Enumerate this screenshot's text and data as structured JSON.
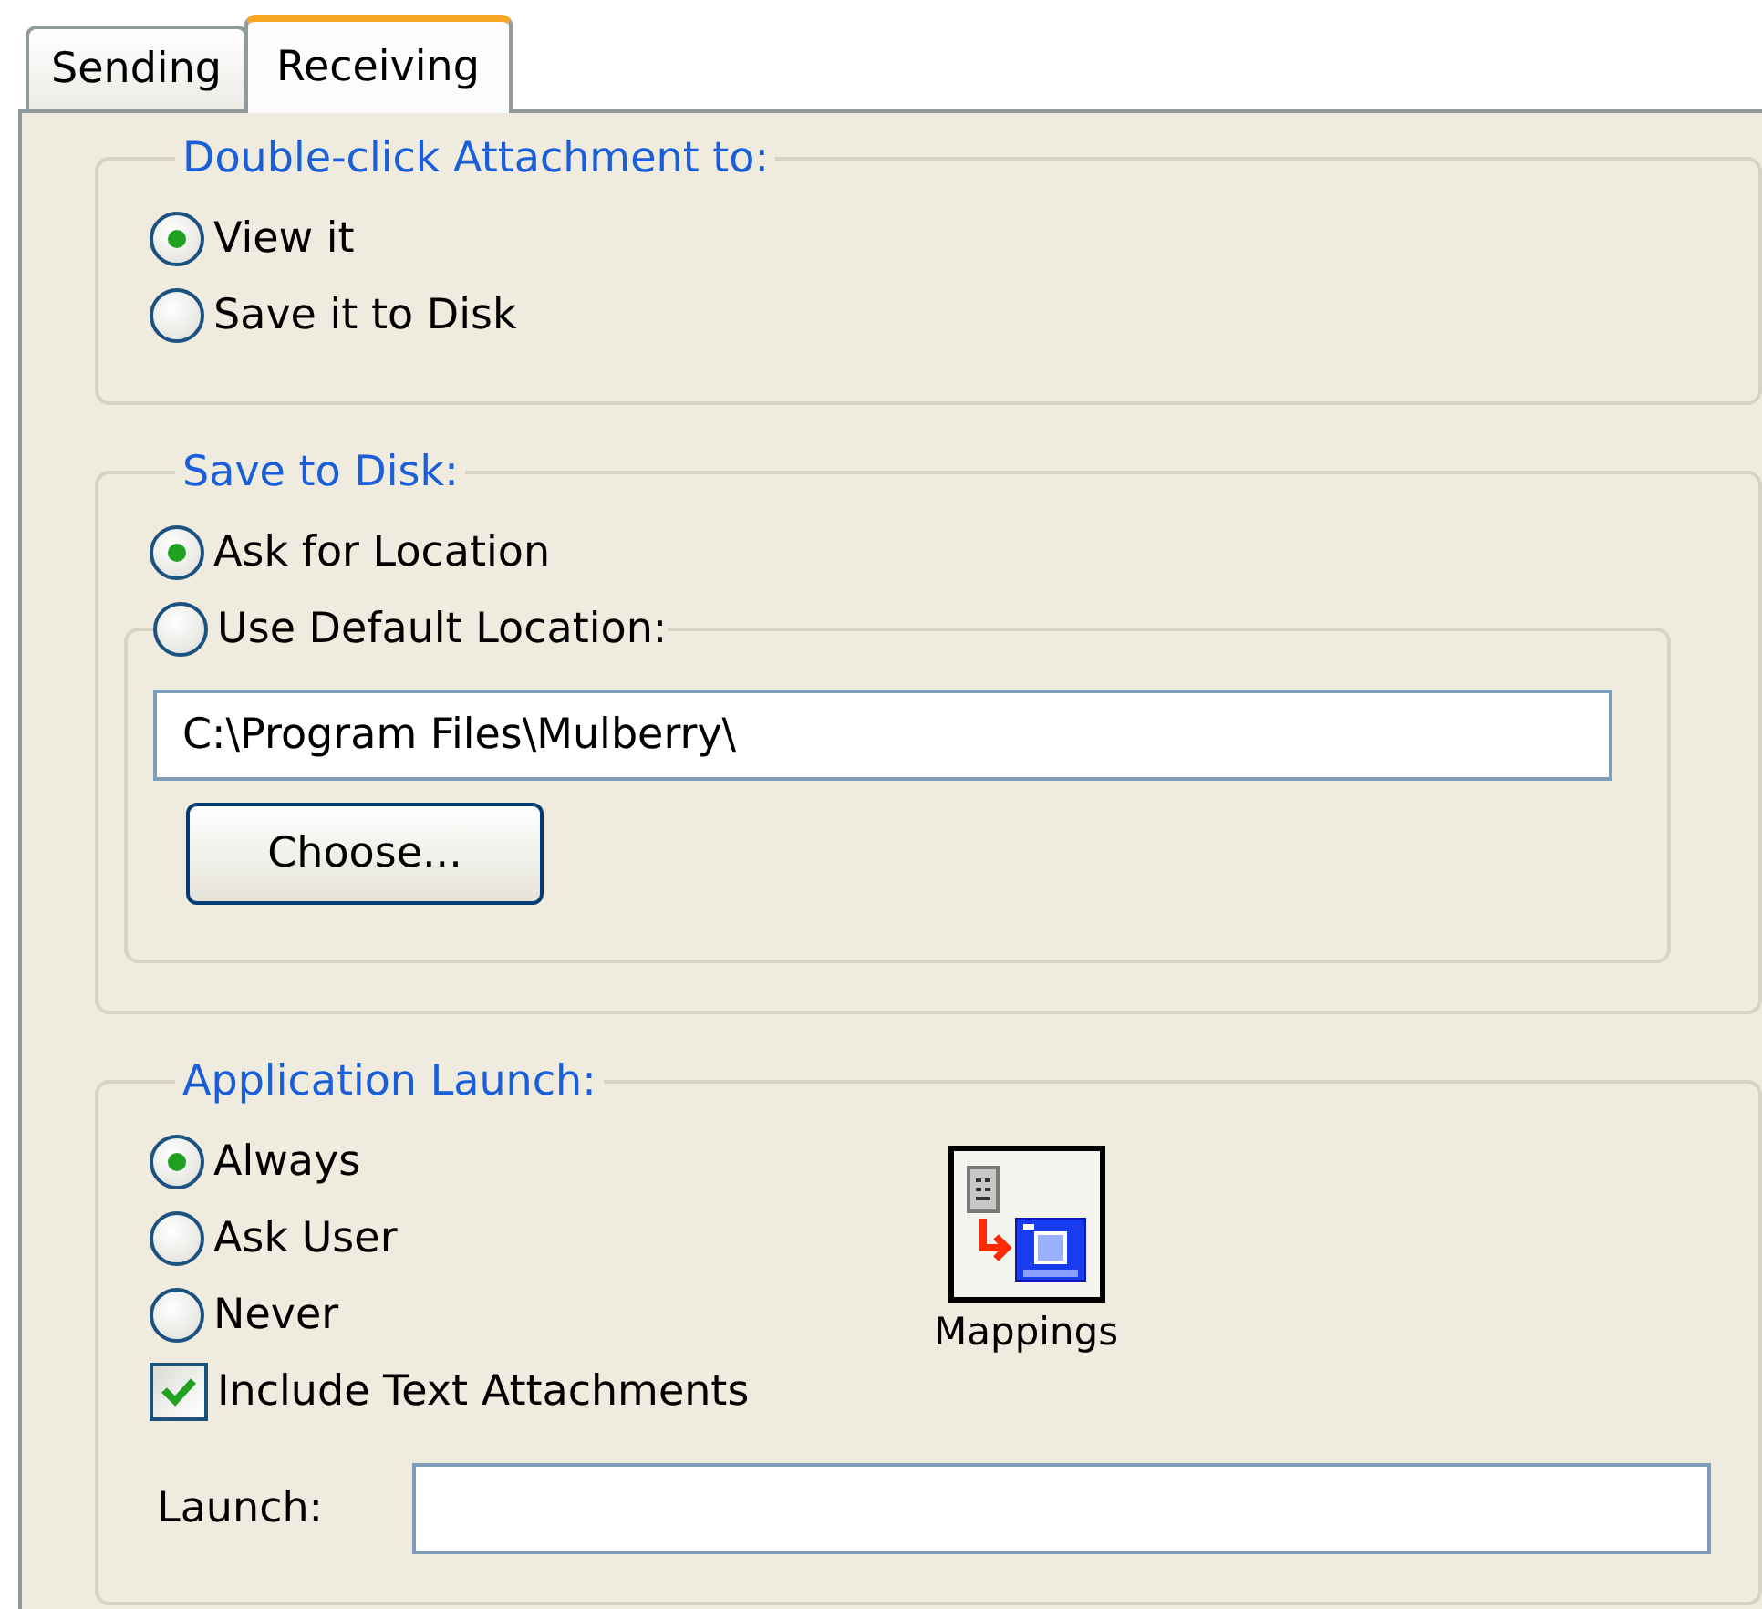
{
  "tabs": [
    {
      "label": "Sending",
      "selected": false
    },
    {
      "label": "Receiving",
      "selected": true
    }
  ],
  "double_click": {
    "title": "Double-click Attachment to:",
    "options": [
      {
        "label": "View it",
        "selected": true
      },
      {
        "label": "Save it to Disk",
        "selected": false
      }
    ]
  },
  "save_to_disk": {
    "title": "Save to Disk:",
    "options": [
      {
        "label": "Ask for Location",
        "selected": true
      },
      {
        "label": "Use Default Location:",
        "selected": false
      }
    ],
    "path": "C:\\Program Files\\Mulberry\\",
    "choose_button": "Choose..."
  },
  "application_launch": {
    "title": "Application Launch:",
    "options": [
      {
        "label": "Always",
        "selected": true
      },
      {
        "label": "Ask User",
        "selected": false
      },
      {
        "label": "Never",
        "selected": false
      }
    ],
    "include_text_attachments": {
      "label": "Include Text Attachments",
      "checked": true
    },
    "mappings_button": "Mappings",
    "launch_label": "Launch:"
  }
}
